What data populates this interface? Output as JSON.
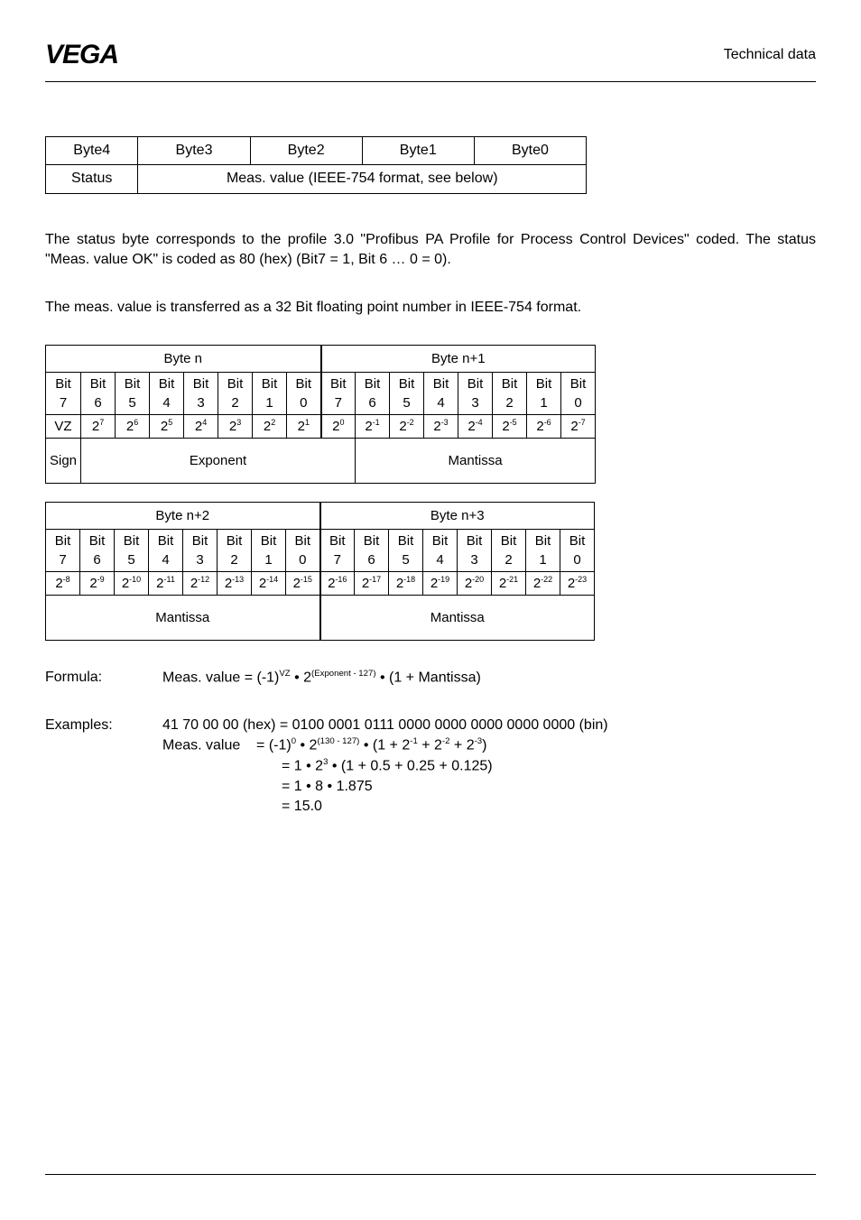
{
  "header": {
    "title": "Technical data"
  },
  "byteTable": {
    "row1": [
      "Byte4",
      "Byte3",
      "Byte2",
      "Byte1",
      "Byte0"
    ],
    "row2_left": "Status",
    "row2_right": "Meas. value (IEEE-754 format, see below)"
  },
  "para1": "The status byte corresponds to the  profile 3.0 \"Profibus PA Profile for Process Control Devices\" coded. The status \"Meas. value OK\" is coded as 80 (hex) (Bit7 = 1, Bit 6 … 0 = 0).",
  "para2": "The meas. value is transferred as a 32 Bit floating point number in IEEE-754 format.",
  "bits1": {
    "byteN": "Byte n",
    "byteN1": "Byte n+1",
    "bitLabels": [
      "Bit 7",
      "Bit 6",
      "Bit 5",
      "Bit 4",
      "Bit 3",
      "Bit 2",
      "Bit 1",
      "Bit 0",
      "Bit 7",
      "Bit 6",
      "Bit 5",
      "Bit 4",
      "Bit 3",
      "Bit 2",
      "Bit 1",
      "Bit 0"
    ],
    "vz": "VZ",
    "sign": "Sign",
    "exponent": "Exponent",
    "mantissa": "Mantissa"
  },
  "bits2": {
    "byteN2": "Byte n+2",
    "byteN3": "Byte n+3",
    "mantissa": "Mantissa"
  },
  "formula": {
    "label": "Formula:",
    "pre": "Meas. value = (-1)",
    "mid1": " • 2",
    "mid2": " • (1 + Mantissa)"
  },
  "examples": {
    "label": "Examples:",
    "line1": "41 70 00 00 (hex) = 0100 0001 0111 0000 0000 0000 0000 0000 (bin)",
    "mvLabel": "Meas. value",
    "l3": "= 1 • 2",
    "l3b": " • (1 + 0.5 + 0.25 + 0.125)",
    "l4": "= 1 • 8 • 1.875",
    "l5": "= 15.0"
  },
  "chart_data": {
    "type": "table",
    "title": "IEEE-754 32-bit floating point bit layout",
    "bytes": [
      {
        "name": "Byte n",
        "role": "Sign + Exponent",
        "bits": [
          {
            "bit": 7,
            "weight": "VZ",
            "group": "Sign"
          },
          {
            "bit": 6,
            "weight": "2^7",
            "group": "Exponent"
          },
          {
            "bit": 5,
            "weight": "2^6",
            "group": "Exponent"
          },
          {
            "bit": 4,
            "weight": "2^5",
            "group": "Exponent"
          },
          {
            "bit": 3,
            "weight": "2^4",
            "group": "Exponent"
          },
          {
            "bit": 2,
            "weight": "2^3",
            "group": "Exponent"
          },
          {
            "bit": 1,
            "weight": "2^2",
            "group": "Exponent"
          },
          {
            "bit": 0,
            "weight": "2^1",
            "group": "Exponent"
          }
        ]
      },
      {
        "name": "Byte n+1",
        "role": "Exponent + Mantissa",
        "bits": [
          {
            "bit": 7,
            "weight": "2^0",
            "group": "Exponent"
          },
          {
            "bit": 6,
            "weight": "2^-1",
            "group": "Mantissa"
          },
          {
            "bit": 5,
            "weight": "2^-2",
            "group": "Mantissa"
          },
          {
            "bit": 4,
            "weight": "2^-3",
            "group": "Mantissa"
          },
          {
            "bit": 3,
            "weight": "2^-4",
            "group": "Mantissa"
          },
          {
            "bit": 2,
            "weight": "2^-5",
            "group": "Mantissa"
          },
          {
            "bit": 1,
            "weight": "2^-6",
            "group": "Mantissa"
          },
          {
            "bit": 0,
            "weight": "2^-7",
            "group": "Mantissa"
          }
        ]
      },
      {
        "name": "Byte n+2",
        "role": "Mantissa",
        "bits": [
          {
            "bit": 7,
            "weight": "2^-8",
            "group": "Mantissa"
          },
          {
            "bit": 6,
            "weight": "2^-9",
            "group": "Mantissa"
          },
          {
            "bit": 5,
            "weight": "2^-10",
            "group": "Mantissa"
          },
          {
            "bit": 4,
            "weight": "2^-11",
            "group": "Mantissa"
          },
          {
            "bit": 3,
            "weight": "2^-12",
            "group": "Mantissa"
          },
          {
            "bit": 2,
            "weight": "2^-13",
            "group": "Mantissa"
          },
          {
            "bit": 1,
            "weight": "2^-14",
            "group": "Mantissa"
          },
          {
            "bit": 0,
            "weight": "2^-15",
            "group": "Mantissa"
          }
        ]
      },
      {
        "name": "Byte n+3",
        "role": "Mantissa",
        "bits": [
          {
            "bit": 7,
            "weight": "2^-16",
            "group": "Mantissa"
          },
          {
            "bit": 6,
            "weight": "2^-17",
            "group": "Mantissa"
          },
          {
            "bit": 5,
            "weight": "2^-18",
            "group": "Mantissa"
          },
          {
            "bit": 4,
            "weight": "2^-19",
            "group": "Mantissa"
          },
          {
            "bit": 3,
            "weight": "2^-20",
            "group": "Mantissa"
          },
          {
            "bit": 2,
            "weight": "2^-21",
            "group": "Mantissa"
          },
          {
            "bit": 1,
            "weight": "2^-22",
            "group": "Mantissa"
          },
          {
            "bit": 0,
            "weight": "2^-23",
            "group": "Mantissa"
          }
        ]
      }
    ],
    "status_byte": {
      "name": "Byte4",
      "meaning": "Status"
    },
    "value_bytes": [
      "Byte3",
      "Byte2",
      "Byte1",
      "Byte0"
    ],
    "formula": "Meas. value = (-1)^VZ * 2^(Exponent - 127) * (1 + Mantissa)",
    "example": {
      "hex": "41 70 00 00",
      "bin": "0100 0001 0111 0000 0000 0000 0000 0000",
      "result": 15.0
    }
  }
}
